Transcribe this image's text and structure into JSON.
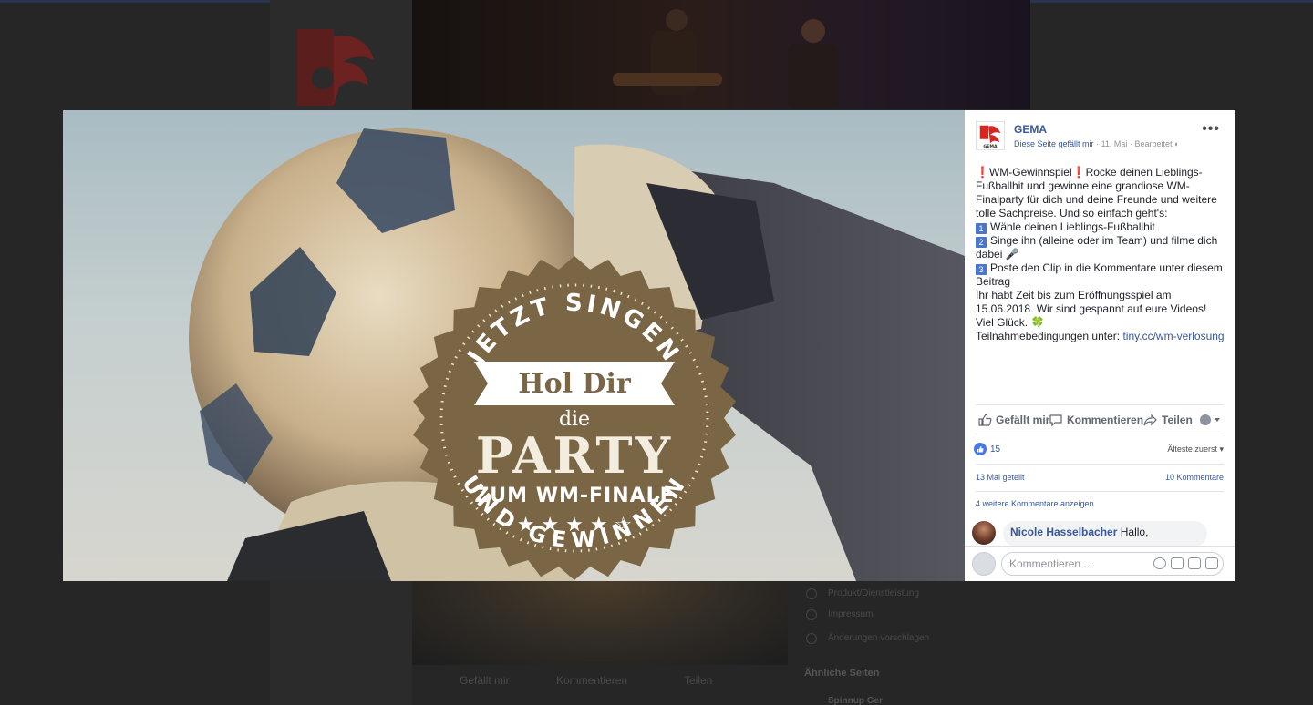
{
  "background": {
    "feed_actions": [
      "Gefällt mir",
      "Kommentieren",
      "Teilen"
    ],
    "sidebar_links": [
      "Produkt/Dienstleistung",
      "Impressum",
      "Änderungen vorschlagen"
    ],
    "similar_pages_title": "Ähnliche Seiten",
    "similar_page_name": "Spinnup Ger"
  },
  "badge": {
    "arc_top": "JETZT SINGEN",
    "line1": "Hol Dir",
    "line2": "die",
    "line3": "PARTY",
    "line4": "ZUM WM-FINALE",
    "stars": "★ ★ ★ ★ ☆",
    "arc_bottom": "UND GEWINNEN"
  },
  "post": {
    "page_name": "GEMA",
    "liked_label": "Diese Seite gefällt mir",
    "date": "11. Mai",
    "edited": "Bearbeitet",
    "more_label": "•••",
    "intro_prefix": "❗",
    "intro_title": "WM-Gewinnspiel",
    "intro_text": "Rocke deinen Lieblings-Fußballhit und gewinne eine grandiose WM-Finalparty für dich und deine Freunde und weitere tolle Sachpreise. Und so einfach geht's:",
    "steps": [
      {
        "num": "1",
        "text": "Wähle deinen Lieblings-Fußballhit"
      },
      {
        "num": "2",
        "text": "Singe ihn (alleine oder im Team) und filme dich dabei 🎤"
      },
      {
        "num": "3",
        "text": "Poste den Clip in die Kommentare unter diesem Beitrag"
      }
    ],
    "deadline_text": "Ihr habt Zeit bis zum Eröffnungsspiel am 15.06.2018. Wir sind gespannt auf eure Videos!",
    "luck_text": "Viel Glück. 🍀",
    "terms_label": "Teilnahmebedingungen unter:",
    "terms_link": "tiny.cc/wm-verlosung"
  },
  "actions": {
    "like": "Gefällt mir",
    "comment": "Kommentieren",
    "share": "Teilen"
  },
  "stats": {
    "likes": "15",
    "sort": "Älteste zuerst",
    "shares": "13 Mal geteilt",
    "comments": "10 Kommentare",
    "more_comments": "4 weitere Kommentare anzeigen"
  },
  "comment": {
    "author": "Nicole Hasselbacher",
    "text": "Hallo,"
  },
  "composer": {
    "placeholder": "Kommentieren ..."
  },
  "colors": {
    "badge_brown": "#7a6545",
    "link_blue": "#365899",
    "like_blue": "#4a77e8",
    "gema_red": "#d6261f"
  }
}
